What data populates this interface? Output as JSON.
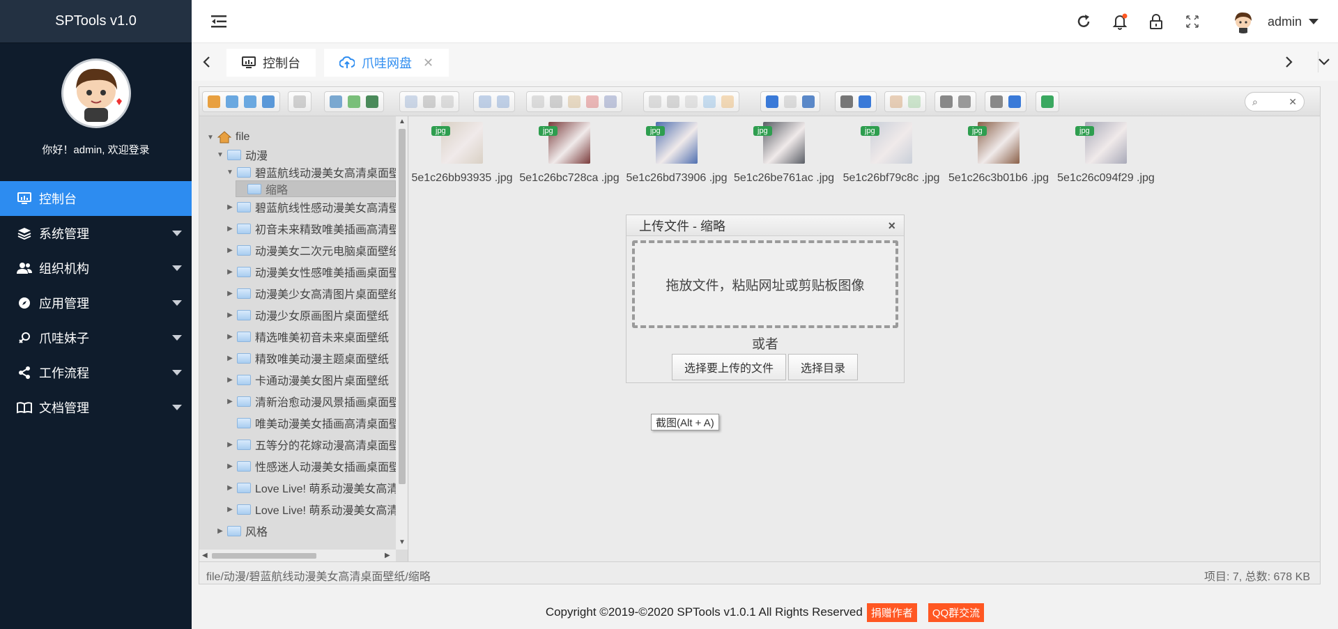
{
  "app": {
    "brand": "SPTools v1.0",
    "welcome": "你好！admin, 欢迎登录"
  },
  "sidebar": {
    "items": [
      {
        "label": "控制台",
        "icon": "dashboard-icon",
        "active": true
      },
      {
        "label": "系统管理",
        "icon": "layers-icon"
      },
      {
        "label": "组织机构",
        "icon": "users-icon"
      },
      {
        "label": "应用管理",
        "icon": "compass-icon"
      },
      {
        "label": "爪哇妹子",
        "icon": "female-icon"
      },
      {
        "label": "工作流程",
        "icon": "share-icon"
      },
      {
        "label": "文档管理",
        "icon": "book-icon"
      }
    ]
  },
  "header": {
    "username": "admin",
    "icons": [
      "refresh-icon",
      "bell-icon",
      "lock-icon",
      "fullscreen-icon"
    ]
  },
  "tabs": [
    {
      "label": "控制台",
      "icon": "monitor-icon"
    },
    {
      "label": "爪哇网盘",
      "icon": "cloud-upload-icon",
      "close": "✕"
    }
  ],
  "tree": {
    "root": "file",
    "nodes": [
      {
        "label": "动漫"
      },
      {
        "label": "碧蓝航线动漫美女高清桌面壁纸"
      },
      {
        "label": "缩略"
      },
      {
        "label": "碧蓝航线性感动漫美女高清壁纸"
      },
      {
        "label": "初音未来精致唯美插画高清壁纸"
      },
      {
        "label": "动漫美女二次元电脑桌面壁纸"
      },
      {
        "label": "动漫美女性感唯美插画桌面壁纸"
      },
      {
        "label": "动漫美少女高清图片桌面壁纸"
      },
      {
        "label": "动漫少女原画图片桌面壁纸"
      },
      {
        "label": "精选唯美初音未来桌面壁纸"
      },
      {
        "label": "精致唯美动漫主题桌面壁纸"
      },
      {
        "label": "卡通动漫美女图片桌面壁纸"
      },
      {
        "label": "清新治愈动漫风景插画桌面壁纸"
      },
      {
        "label": "唯美动漫美女插画高清桌面壁纸"
      },
      {
        "label": "五等分的花嫁动漫高清桌面壁纸"
      },
      {
        "label": "性感迷人动漫美女插画桌面壁纸"
      },
      {
        "label": "Love Live! 萌系动漫美女高清壁纸"
      },
      {
        "label": "Love Live! 萌系动漫美女高清桌面壁纸"
      },
      {
        "label": "风格"
      }
    ]
  },
  "files": [
    {
      "name": "5e1c26bb93935 .jpg",
      "badge": "jpg",
      "color": "#d9d0c4"
    },
    {
      "name": "5e1c26bc728ca .jpg",
      "badge": "jpg",
      "color": "#7a3b3b"
    },
    {
      "name": "5e1c26bd73906 .jpg",
      "badge": "jpg",
      "color": "#4f6fb0"
    },
    {
      "name": "5e1c26be761ac .jpg",
      "badge": "jpg",
      "color": "#5a5e66"
    },
    {
      "name": "5e1c26bf79c8c .jpg",
      "badge": "jpg",
      "color": "#c9cfd9"
    },
    {
      "name": "5e1c26c3b01b6 .jpg",
      "badge": "jpg",
      "color": "#8a6048"
    },
    {
      "name": "5e1c26c094f29 .jpg",
      "badge": "jpg",
      "color": "#a8a9b8"
    }
  ],
  "status": {
    "path": "file/动漫/碧蓝航线动漫美女高清桌面壁纸/缩略",
    "info": "项目: 7, 总数: 678 KB"
  },
  "upload": {
    "title": "上传文件 - 缩略",
    "close": "×",
    "dropzone": "拖放文件，粘贴网址或剪贴板图像",
    "or": "或者",
    "select_files": "选择要上传的文件",
    "select_dir": "选择目录"
  },
  "tooltip": "截图(Alt + A)",
  "footer": {
    "copyright": "Copyright ©2019-©2020 SPTools v1.0.1 All Rights Reserved",
    "donate": "捐赠作者",
    "qq": "QQ群交流"
  },
  "colors": {
    "sidebar_bg": "#0f1c2c",
    "accent": "#2d8cf0",
    "badge": "#ff5722",
    "jpg_badge": "#2e9e4f"
  }
}
